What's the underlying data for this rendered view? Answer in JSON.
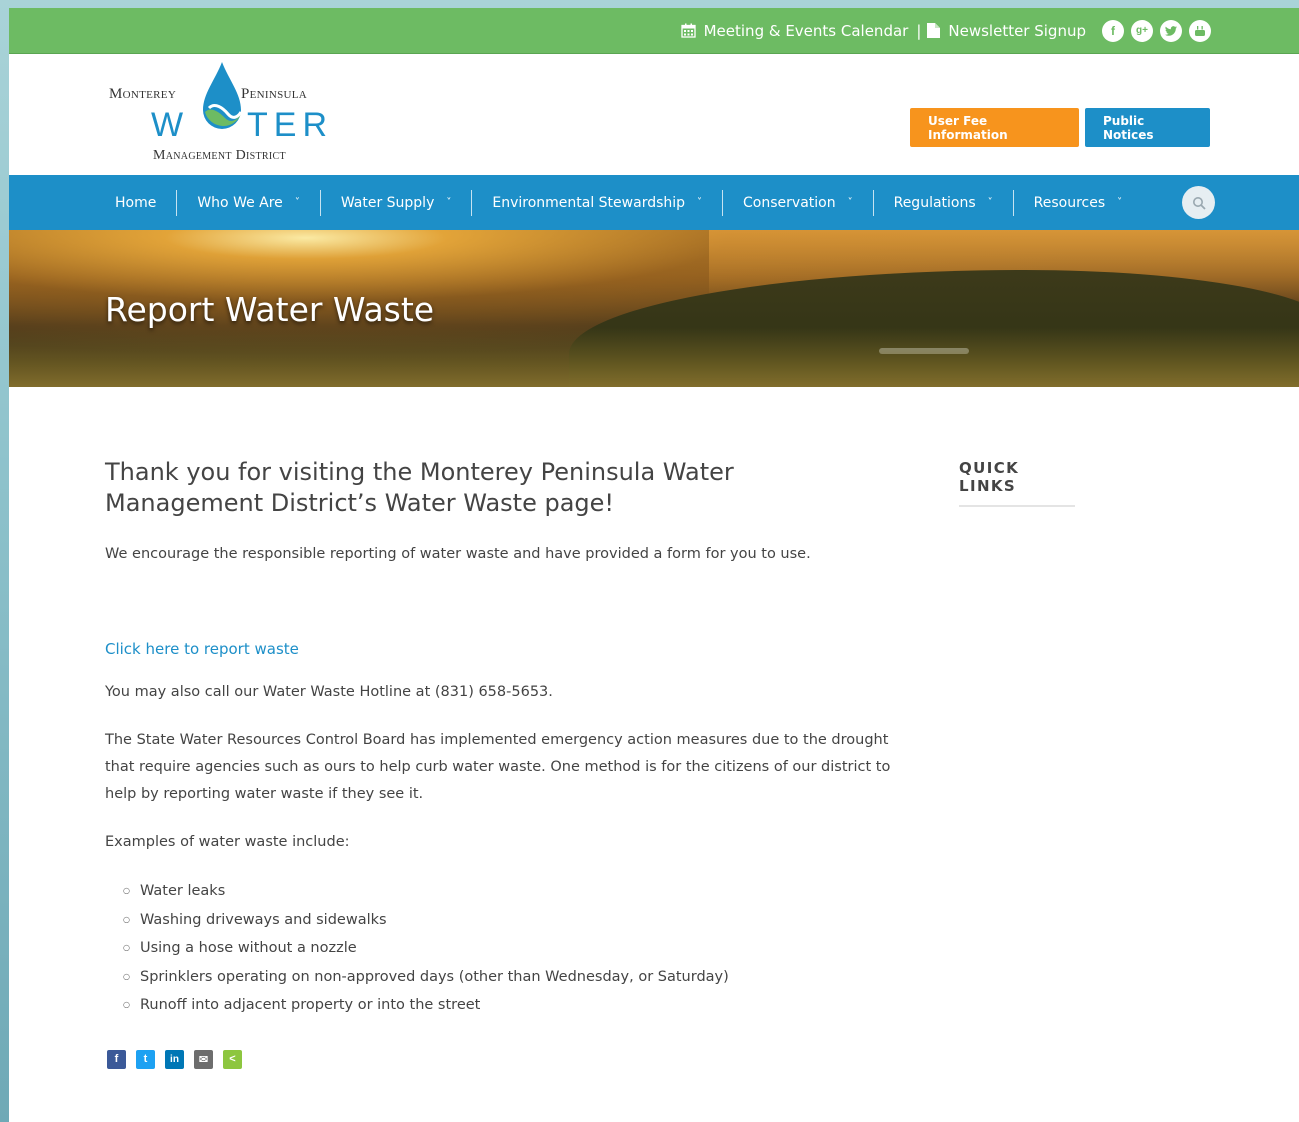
{
  "topbar": {
    "calendar_label": "Meeting & Events Calendar",
    "separator": "|",
    "newsletter_label": "Newsletter Signup",
    "socials": [
      "facebook-icon",
      "google-plus-icon",
      "twitter-icon",
      "youtube-icon"
    ]
  },
  "logo": {
    "line1a": "Monterey",
    "line1b": "Peninsula",
    "water_a": "W",
    "water_b": "TER",
    "line3": "Management District"
  },
  "header": {
    "fee_button": "User Fee Information",
    "notices_button": "Public Notices"
  },
  "nav": {
    "items": [
      {
        "label": "Home",
        "has_dropdown": false
      },
      {
        "label": "Who We Are",
        "has_dropdown": true
      },
      {
        "label": "Water Supply",
        "has_dropdown": true
      },
      {
        "label": "Environmental Stewardship",
        "has_dropdown": true
      },
      {
        "label": "Conservation",
        "has_dropdown": true
      },
      {
        "label": "Regulations",
        "has_dropdown": true
      },
      {
        "label": "Resources",
        "has_dropdown": true
      }
    ],
    "chevron": "˅"
  },
  "hero": {
    "title": "Report Water Waste"
  },
  "main": {
    "heading": "Thank you for visiting the Monterey Peninsula Water Management District’s Water Waste page!",
    "intro": "We encourage the responsible reporting of water waste and have provided a form for you to use.",
    "report_link": "Click here to report waste",
    "hotline": "You may also call our Water Waste Hotline at (831) 658-5653.",
    "state_board": "The State Water Resources Control Board has implemented emergency action measures due to the drought that require agencies such as ours to help curb water waste. One method is for the citizens of our district to help by reporting water waste if they see it.",
    "examples_intro": "Examples of water waste include:",
    "examples": [
      "Water leaks",
      "Washing driveways and sidewalks",
      "Using a hose without a nozzle",
      "Sprinklers operating on non-approved days (other than Wednesday, or Saturday)",
      "Runoff into adjacent property or into the street"
    ],
    "share": [
      {
        "icon": "facebook-share-icon",
        "glyph": "f",
        "color": "#3b5998"
      },
      {
        "icon": "twitter-share-icon",
        "glyph": "t",
        "color": "#1da1f2"
      },
      {
        "icon": "linkedin-share-icon",
        "glyph": "in",
        "color": "#0077b5"
      },
      {
        "icon": "email-share-icon",
        "glyph": "✉",
        "color": "#6d6d6d"
      },
      {
        "icon": "sharethis-icon",
        "glyph": "<",
        "color": "#8dc63f"
      }
    ]
  },
  "sidebar": {
    "quick_links_title": "QUICK LINKS"
  },
  "colors": {
    "green_bar": "#6dbb63",
    "blue": "#1d8fc8",
    "orange": "#f7941d"
  }
}
